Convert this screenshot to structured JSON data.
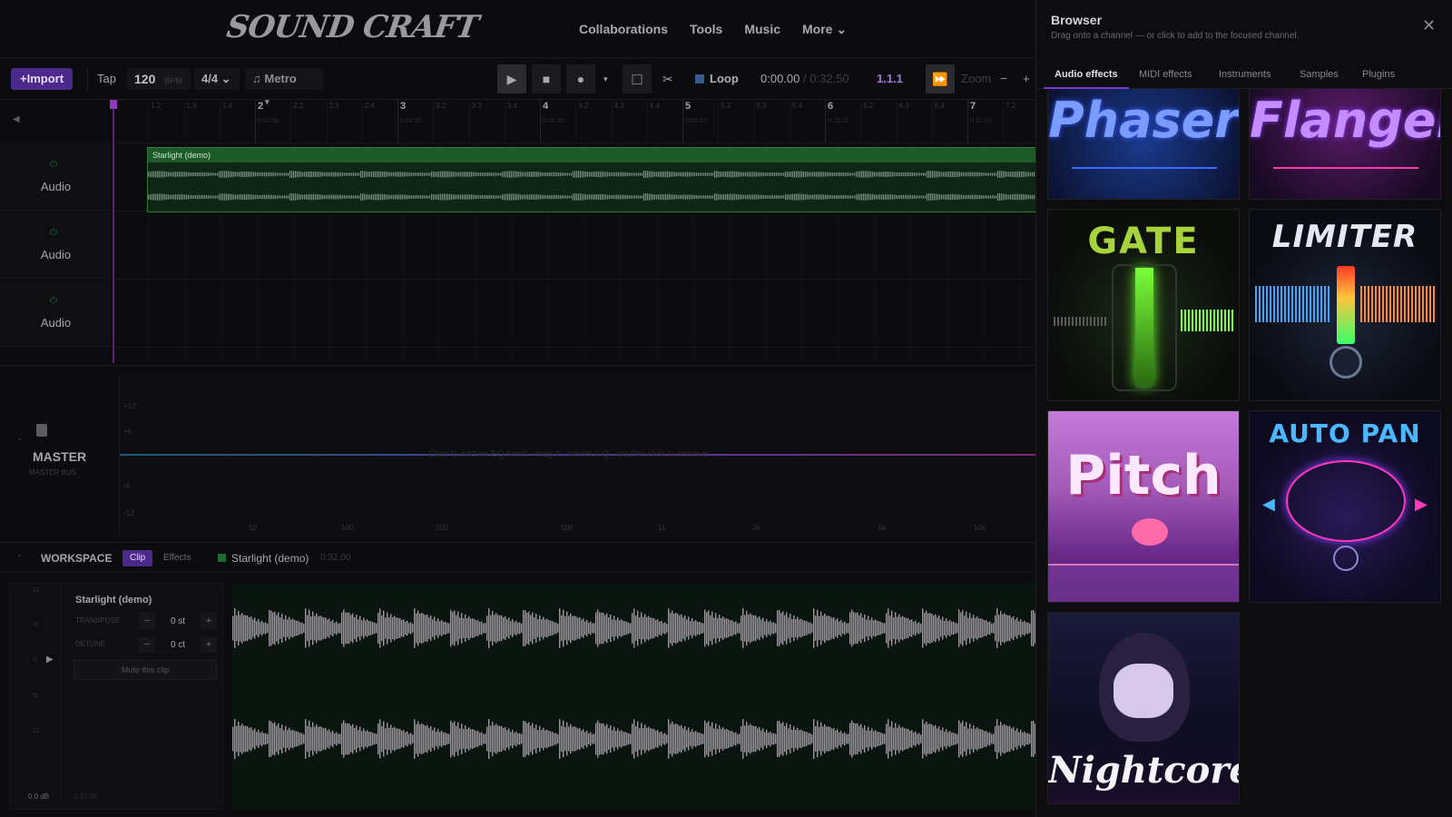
{
  "app": {
    "logo": "SOUND CRAFT"
  },
  "nav": {
    "items": [
      "Collaborations",
      "Tools",
      "Music",
      "More ⌄"
    ]
  },
  "toolbar": {
    "import": "+Import",
    "tap": "Tap",
    "bpm": "120",
    "bpm_unit": "BPM",
    "time_sig": "4/4 ⌄",
    "metro": "♫ Metro",
    "metro_caret": "▾",
    "play": "▶",
    "stop": "■",
    "record": "●",
    "record_caret": "▾",
    "loop_box": "□",
    "scissors": "✂",
    "loop": "Loop",
    "time_cur": "0:00.00",
    "time_total": "/ 0:32.50",
    "position": "1.1.1",
    "follow": "⏩",
    "zoom_label": "Zoom",
    "zoom_minus": "−",
    "zoom_plus": "+"
  },
  "ruler": {
    "collapse": "◀",
    "bars": [
      "2",
      "3",
      "4",
      "5",
      "6",
      "7"
    ],
    "bar_times": [
      "0:02.00",
      "0:04.00",
      "0:06.00",
      "0:08.00",
      "0:10.00",
      "0:12.00"
    ]
  },
  "tracks": [
    {
      "label": "Audio",
      "power": "⏻"
    },
    {
      "label": "Audio",
      "power": "⏻"
    },
    {
      "label": "Audio",
      "power": "⏻"
    }
  ],
  "clip": {
    "title": "Starlight (demo)"
  },
  "master": {
    "name": "MASTER",
    "sub": "MASTER BUS",
    "hint": "Click to add an EQ band · drag it · wheel = Q · double-click to remove",
    "db_labels": [
      "+12",
      "+6",
      "-6",
      "-12"
    ],
    "freq_labels": [
      "50",
      "100",
      "200",
      "500",
      "1k",
      "2k",
      "5k",
      "10k"
    ]
  },
  "workspace": {
    "title": "WORKSPACE",
    "tab_clip": "Clip",
    "tab_effects": "Effects",
    "clip_name": "Starlight (demo)",
    "clip_duration": "0:32.00",
    "panel_title": "Starlight (demo)",
    "transpose_label": "TRANSPOSE",
    "transpose_value": "0 st",
    "detune_label": "DETUNE",
    "detune_value": "0 ct",
    "minus": "−",
    "plus": "+",
    "mute_clip": "Mute this clip",
    "meter_labels": [
      "-12",
      "-6",
      "0",
      "6",
      "-12"
    ],
    "gain": "0.0 dB",
    "gain_time": "0:32.00"
  },
  "browser": {
    "title": "Browser",
    "subtitle": "Drag onto a channel — or click to add to the focused channel.",
    "close": "✕",
    "tabs": [
      "Audio effects",
      "MIDI effects",
      "Instruments",
      "Samples",
      "Plugins"
    ],
    "cards": [
      "Phaser",
      "Flanger",
      "GATE",
      "LIMITER",
      "Pitch",
      "AUTO PAN",
      "Nightcore"
    ]
  }
}
